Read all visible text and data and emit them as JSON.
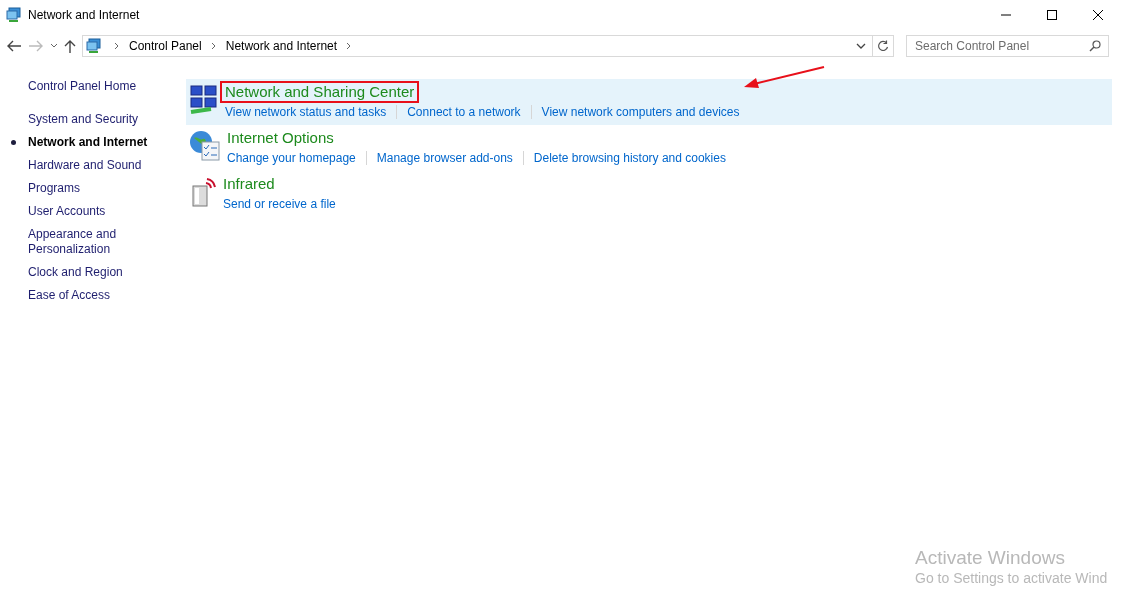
{
  "window": {
    "title": "Network and Internet"
  },
  "address_bar": {
    "crumbs": [
      "Control Panel",
      "Network and Internet"
    ]
  },
  "search": {
    "placeholder": "Search Control Panel"
  },
  "sidebar": {
    "home": "Control Panel Home",
    "items": [
      {
        "label": "System and Security",
        "selected": false
      },
      {
        "label": "Network and Internet",
        "selected": true
      },
      {
        "label": "Hardware and Sound",
        "selected": false
      },
      {
        "label": "Programs",
        "selected": false
      },
      {
        "label": "User Accounts",
        "selected": false
      },
      {
        "label": "Appearance and Personalization",
        "selected": false
      },
      {
        "label": "Clock and Region",
        "selected": false
      },
      {
        "label": "Ease of Access",
        "selected": false
      }
    ]
  },
  "categories": [
    {
      "kind": "network",
      "title": "Network and Sharing Center",
      "selected": true,
      "annotated": true,
      "links": [
        "View network status and tasks",
        "Connect to a network",
        "View network computers and devices"
      ]
    },
    {
      "kind": "internet",
      "title": "Internet Options",
      "selected": false,
      "annotated": false,
      "links": [
        "Change your homepage",
        "Manage browser add-ons",
        "Delete browsing history and cookies"
      ]
    },
    {
      "kind": "infrared",
      "title": "Infrared",
      "selected": false,
      "annotated": false,
      "links": [
        "Send or receive a file"
      ]
    }
  ],
  "activation": {
    "title": "Activate Windows",
    "message": "Go to Settings to activate Wind"
  }
}
